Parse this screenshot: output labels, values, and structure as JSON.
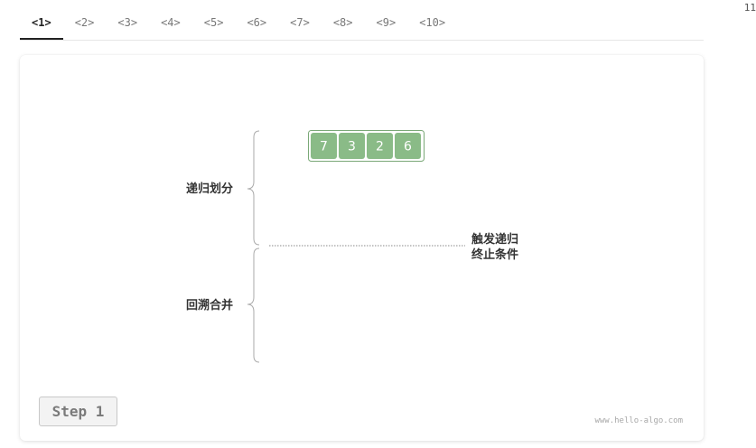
{
  "tabs": [
    "<1>",
    "<2>",
    "<3>",
    "<4>",
    "<5>",
    "<6>",
    "<7>",
    "<8>",
    "<9>",
    "<10>"
  ],
  "active_tab": 0,
  "corner_number": "11",
  "diagram": {
    "array_values": [
      "7",
      "3",
      "2",
      "6"
    ],
    "cell_color": "#8abb87",
    "label_divide": "递归划分",
    "label_merge": "回溯合并",
    "label_trigger_line1": "触发递归",
    "label_trigger_line2": "终止条件"
  },
  "step_button_label": "Step 1",
  "watermark": "www.hello-algo.com"
}
